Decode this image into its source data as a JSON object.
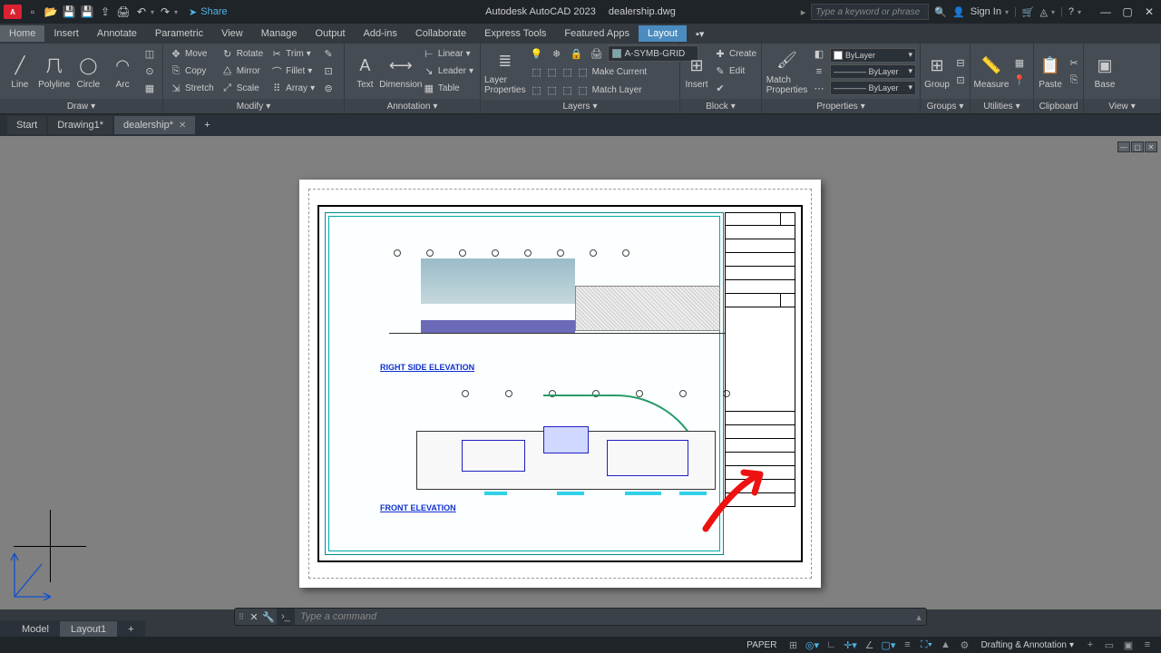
{
  "titlebar": {
    "app_abbrev": "A",
    "share_label": "Share",
    "app_title": "Autodesk AutoCAD 2023",
    "doc_title": "dealership.dwg",
    "search_placeholder": "Type a keyword or phrase",
    "signin_label": "Sign In"
  },
  "menu": {
    "tabs": [
      "Home",
      "Insert",
      "Annotate",
      "Parametric",
      "View",
      "Manage",
      "Output",
      "Add-ins",
      "Collaborate",
      "Express Tools",
      "Featured Apps",
      "Layout"
    ]
  },
  "ribbon": {
    "draw": {
      "title": "Draw",
      "line": "Line",
      "polyline": "Polyline",
      "circle": "Circle",
      "arc": "Arc"
    },
    "modify": {
      "title": "Modify",
      "move": "Move",
      "rotate": "Rotate",
      "trim": "Trim",
      "copy": "Copy",
      "mirror": "Mirror",
      "fillet": "Fillet",
      "stretch": "Stretch",
      "scale": "Scale",
      "array": "Array"
    },
    "annotation": {
      "title": "Annotation",
      "text": "Text",
      "dimension": "Dimension",
      "linear": "Linear",
      "leader": "Leader",
      "table": "Table"
    },
    "layers": {
      "title": "Layers",
      "properties": "Layer\nProperties",
      "current_layer": "A-SYMB-GRID",
      "make_current": "Make Current",
      "match_layer": "Match Layer"
    },
    "block": {
      "title": "Block",
      "insert": "Insert",
      "create": "Create",
      "edit": "Edit"
    },
    "properties": {
      "title": "Properties",
      "match": "Match\nProperties",
      "bylayer1": "ByLayer",
      "bylayer2": "ByLayer",
      "bylayer3": "ByLayer"
    },
    "groups": {
      "title": "Groups",
      "group": "Group"
    },
    "utilities": {
      "title": "Utilities",
      "measure": "Measure"
    },
    "clipboard": {
      "title": "Clipboard",
      "paste": "Paste"
    },
    "view": {
      "title": "View",
      "base": "Base"
    }
  },
  "filetabs": {
    "start": "Start",
    "drawing1": "Drawing1*",
    "dealership": "dealership*"
  },
  "drawing": {
    "caption1": "RIGHT SIDE ELEVATION",
    "caption2": "FRONT ELEVATION"
  },
  "cmdline": {
    "placeholder": "Type a command"
  },
  "layouttabs": {
    "model": "Model",
    "layout1": "Layout1"
  },
  "statusbar": {
    "space": "PAPER",
    "workspace": "Drafting & Annotation"
  }
}
